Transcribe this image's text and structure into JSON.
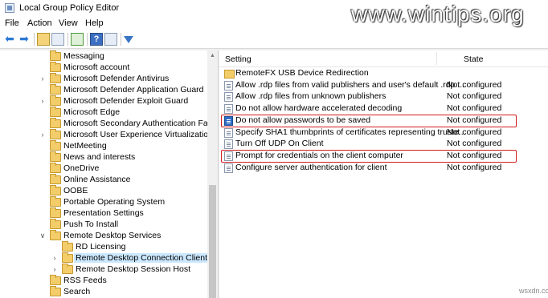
{
  "window": {
    "title": "Local Group Policy Editor"
  },
  "watermark": "www.wintips.org",
  "corner_watermark": "wsxdn.com",
  "menu": [
    "File",
    "Action",
    "View",
    "Help"
  ],
  "tree": [
    {
      "label": "Messaging",
      "expandable": false,
      "level": 0
    },
    {
      "label": "Microsoft account",
      "expandable": false,
      "level": 0
    },
    {
      "label": "Microsoft Defender Antivirus",
      "expandable": true,
      "level": 0
    },
    {
      "label": "Microsoft Defender Application Guard",
      "expandable": false,
      "level": 0
    },
    {
      "label": "Microsoft Defender Exploit Guard",
      "expandable": true,
      "level": 0
    },
    {
      "label": "Microsoft Edge",
      "expandable": false,
      "level": 0
    },
    {
      "label": "Microsoft Secondary Authentication Factor",
      "expandable": false,
      "level": 0
    },
    {
      "label": "Microsoft User Experience Virtualization",
      "expandable": true,
      "level": 0
    },
    {
      "label": "NetMeeting",
      "expandable": false,
      "level": 0
    },
    {
      "label": "News and interests",
      "expandable": false,
      "level": 0
    },
    {
      "label": "OneDrive",
      "expandable": false,
      "level": 0
    },
    {
      "label": "Online Assistance",
      "expandable": false,
      "level": 0
    },
    {
      "label": "OOBE",
      "expandable": false,
      "level": 0
    },
    {
      "label": "Portable Operating System",
      "expandable": false,
      "level": 0
    },
    {
      "label": "Presentation Settings",
      "expandable": false,
      "level": 0
    },
    {
      "label": "Push To Install",
      "expandable": false,
      "level": 0
    },
    {
      "label": "Remote Desktop Services",
      "expandable": "open",
      "level": 0
    },
    {
      "label": "RD Licensing",
      "expandable": false,
      "level": 1
    },
    {
      "label": "Remote Desktop Connection Client",
      "expandable": true,
      "level": 1,
      "selected": true
    },
    {
      "label": "Remote Desktop Session Host",
      "expandable": true,
      "level": 1
    },
    {
      "label": "RSS Feeds",
      "expandable": false,
      "level": 0
    },
    {
      "label": "Search",
      "expandable": false,
      "level": 0
    }
  ],
  "columns": {
    "setting": "Setting",
    "state": "State"
  },
  "settings": [
    {
      "name": "RemoteFX USB Device Redirection",
      "state": "",
      "type": "folder"
    },
    {
      "name": "Allow .rdp files from valid publishers and user's default .rdp ...",
      "state": "Not configured",
      "type": "policy"
    },
    {
      "name": "Allow .rdp files from unknown publishers",
      "state": "Not configured",
      "type": "policy"
    },
    {
      "name": "Do not allow hardware accelerated decoding",
      "state": "Not configured",
      "type": "policy"
    },
    {
      "name": "Do not allow passwords to be saved",
      "state": "Not configured",
      "type": "policy",
      "highlighted": true,
      "selected": true
    },
    {
      "name": "Specify SHA1 thumbprints of certificates representing truste...",
      "state": "Not configured",
      "type": "policy"
    },
    {
      "name": "Turn Off UDP On Client",
      "state": "Not configured",
      "type": "policy"
    },
    {
      "name": "Prompt for credentials on the client computer",
      "state": "Not configured",
      "type": "policy",
      "highlighted": true
    },
    {
      "name": "Configure server authentication for client",
      "state": "Not configured",
      "type": "policy"
    }
  ],
  "colors": {
    "highlight_border": "#d11d1d",
    "selection": "#cce8ff",
    "folder": "#f3cd6a"
  }
}
